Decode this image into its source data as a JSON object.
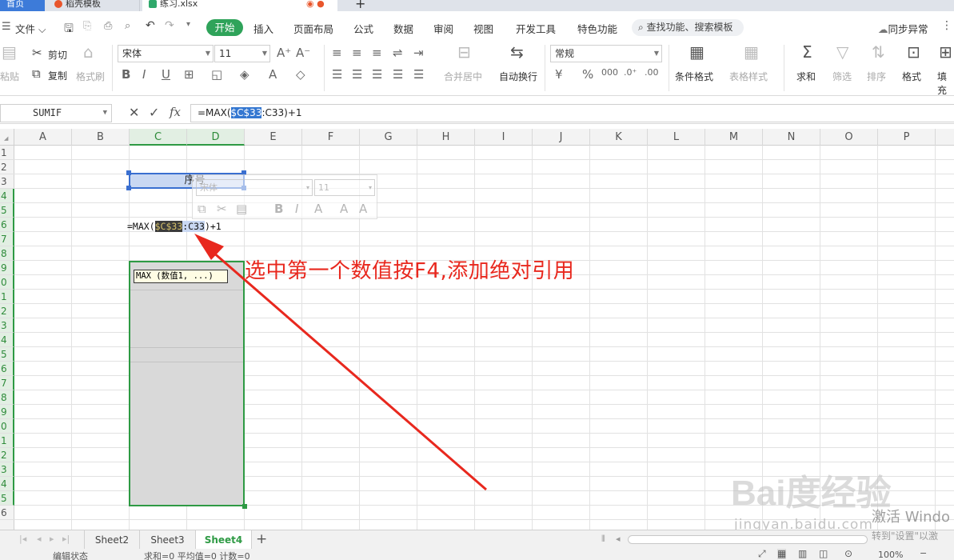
{
  "titlebar": {
    "home_tab": "首页",
    "template_tab": "稻壳模板",
    "doc_tab": "练习.xlsx",
    "new_tab": "+"
  },
  "menu": {
    "file": "文件",
    "start": "开始",
    "items": [
      "插入",
      "页面布局",
      "公式",
      "数据",
      "审阅",
      "视图",
      "开发工具",
      "特色功能"
    ],
    "search": "查找功能、搜索模板",
    "sync": "同步异常"
  },
  "ribbon": {
    "paste": "粘贴",
    "cut": "剪切",
    "copy": "复制",
    "format_painter": "格式刷",
    "font_name": "宋体",
    "font_size": "11",
    "merge_center": "合并居中",
    "wrap_text": "自动换行",
    "number_format": "常规",
    "conditional_format": "条件格式",
    "table_style": "表格样式",
    "sum": "求和",
    "filter": "筛选",
    "sort": "排序",
    "format": "格式",
    "fill": "填充"
  },
  "formula_bar": {
    "name_box": "SUMIF",
    "fx": "fx",
    "prefix": "=MAX(",
    "highlight": "$C$33",
    "suffix": ":C33)+1"
  },
  "columns": [
    "A",
    "B",
    "C",
    "D",
    "E",
    "F",
    "G",
    "H",
    "I",
    "J",
    "K",
    "L",
    "M",
    "N",
    "O",
    "P"
  ],
  "rows": [
    "1",
    "2",
    "3",
    "4",
    "5",
    "6",
    "7",
    "8",
    "9",
    "0",
    "1",
    "2",
    "3",
    "4",
    "5",
    "6",
    "7",
    "8",
    "9",
    "0",
    "1",
    "2",
    "3",
    "4",
    "5",
    "6"
  ],
  "cells": {
    "header_text": "序号",
    "formula_prefix": "=MAX(",
    "formula_ref": "$C$33",
    "formula_ref2": ":C33",
    "formula_suffix": ")+1",
    "tooltip": "MAX (数值1, ...)"
  },
  "mini_toolbar": {
    "font_name": "宋体",
    "font_size": "11"
  },
  "annotation": "选中第一个数值按F4,添加绝对引用",
  "sheets": [
    "Sheet2",
    "Sheet3",
    "Sheet4"
  ],
  "active_sheet": "Sheet4",
  "status": {
    "mode": "编辑状态",
    "stats": "求和=0  平均值=0  计数=0",
    "zoom": "100%"
  },
  "watermark": {
    "logo": "Bai度经验",
    "url": "jingyan.baidu.com"
  },
  "activation": {
    "line1": "激活 Windo",
    "line2": "转到\"设置\"以激"
  }
}
